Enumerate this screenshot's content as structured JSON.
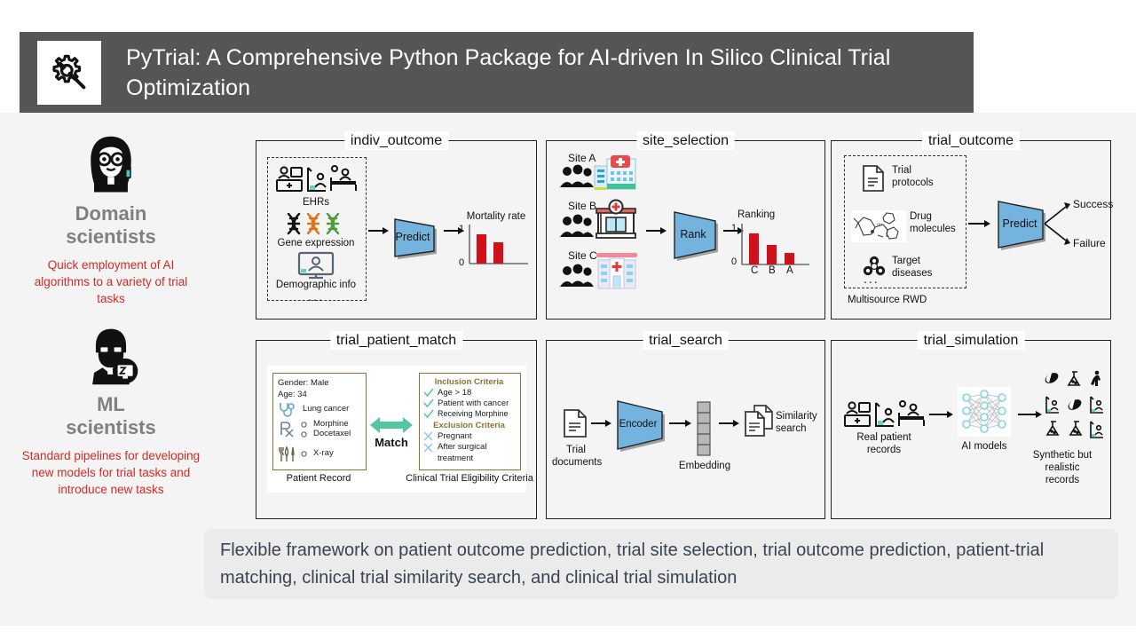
{
  "header": {
    "title": "PyTrial: A Comprehensive Python Package for AI-driven In Silico Clinical Trial Optimization",
    "logo_icon": "gear-wrench-icon",
    "bar_color": "#555555",
    "title_color": "#ffffff"
  },
  "personas": [
    {
      "icon": "female-scientist-avatar-icon",
      "title": "Domain\nscientists",
      "title_line1": "Domain",
      "title_line2": "scientists",
      "description": "Quick employment  of AI algorithms to a variety  of trial tasks",
      "title_color": "#808080",
      "description_color": "#d42a24"
    },
    {
      "icon": "male-ml-engineer-avatar-icon",
      "title_line1": "ML",
      "title_line2": "scientists",
      "description": "Standard pipelines for developing new models for trial tasks and introduce new tasks",
      "title_color": "#808080",
      "description_color": "#d42a24"
    }
  ],
  "panels": {
    "indiv_outcome": {
      "label": "indiv_outcome",
      "input_group_items": [
        {
          "icon": "ehr-icons",
          "label": "EHRs"
        },
        {
          "icon": "dna-helix-icons",
          "label": "Gene expression"
        },
        {
          "icon": "monitor-demographics-icon",
          "label": "Demographic info"
        },
        {
          "icon": "ellipsis",
          "label": "..."
        }
      ],
      "model_label": "Predict",
      "output_title": "Mortality rate",
      "axis_max": "1",
      "axis_min": "0",
      "bars": [
        0.75,
        0.55
      ],
      "bar_color": "#d0111b",
      "model_color": "#74b3dd"
    },
    "site_selection": {
      "label": "site_selection",
      "sites": [
        {
          "name": "Site A",
          "icon": "hospital-building-a-icon"
        },
        {
          "name": "Site B",
          "icon": "clinic-building-b-icon"
        },
        {
          "name": "Site C",
          "icon": "hospital-building-c-icon"
        }
      ],
      "model_label": "Rank",
      "output_title": "Ranking",
      "axis_max": "1",
      "axis_min": "0",
      "categories": [
        "C",
        "B",
        "A"
      ],
      "bars": [
        0.8,
        0.5,
        0.3
      ],
      "bar_color": "#d0111b",
      "model_color": "#74b3dd"
    },
    "trial_outcome": {
      "label": "trial_outcome",
      "input_group_items": [
        {
          "icon": "document-icon",
          "label": "Trial protocols"
        },
        {
          "icon": "molecule-structure-icon",
          "label": "Drug molecules"
        },
        {
          "icon": "biohazard-icon",
          "label": "Target diseases"
        },
        {
          "icon": "ellipsis",
          "label": "..."
        }
      ],
      "input_group_caption": "Multisource RWD",
      "model_label": "Predict",
      "outputs": [
        "Success",
        "Failure"
      ],
      "model_color": "#74b3dd"
    },
    "trial_patient_match": {
      "label": "trial_patient_match",
      "patient": {
        "gender_line": "Gender: Male",
        "age_line": "Age: 34",
        "condition": "Lung cancer",
        "condition_icon": "stethoscope-icon",
        "medications_icon": "prescription-rx-icon",
        "medications": [
          "Morphine",
          "Docetaxel"
        ],
        "procedures_icon": "surgical-tools-icon",
        "procedures": [
          "X-ray"
        ],
        "caption": "Patient Record"
      },
      "criteria": {
        "inclusion_title": "Inclusion Criteria",
        "inclusion": [
          "Age > 18",
          "Patient with cancer",
          "Receiving Morphine"
        ],
        "exclusion_title": "Exclusion Criteria",
        "exclusion": [
          "Pregnant",
          "After surgical treatment"
        ],
        "caption": "Clinical Trial Eligibility Criteria",
        "check_color": "#5ec4a0",
        "cross_color": "#8fc8e0",
        "title_color": "#8a7233"
      },
      "match_label": "Match",
      "match_arrow_color": "#54c69e"
    },
    "trial_search": {
      "label": "trial_search",
      "input_label": "Trial documents",
      "input_icon": "document-icon",
      "model_label": "Encoder",
      "embedding_label": "Embedding",
      "embedding_cells": 5,
      "output_label": "Similarity search",
      "output_icon": "documents-stack-icon",
      "model_color": "#74b3dd"
    },
    "trial_simulation": {
      "label": "trial_simulation",
      "input_label": "Real patient records",
      "input_icon": "ehr-icons",
      "model_label": "AI models",
      "model_icon": "neural-network-icon",
      "output_label": "Synthetic but realistic records",
      "output_icons": [
        "pill-icon",
        "flask-icon",
        "walking-person-icon",
        "patient-chart-icon",
        "pill-icon",
        "patient-chart-icon",
        "flask-icon",
        "flask-icon",
        "patient-chart-icon"
      ],
      "network_color": "#7fd3ef"
    }
  },
  "caption": {
    "text": "Flexible framework on patient outcome prediction, trial site selection, trial outcome prediction, patient-trial matching, clinical trial similarity search, and clinical trial simulation",
    "background": "#ebebeb",
    "text_color": "#3a4354"
  }
}
